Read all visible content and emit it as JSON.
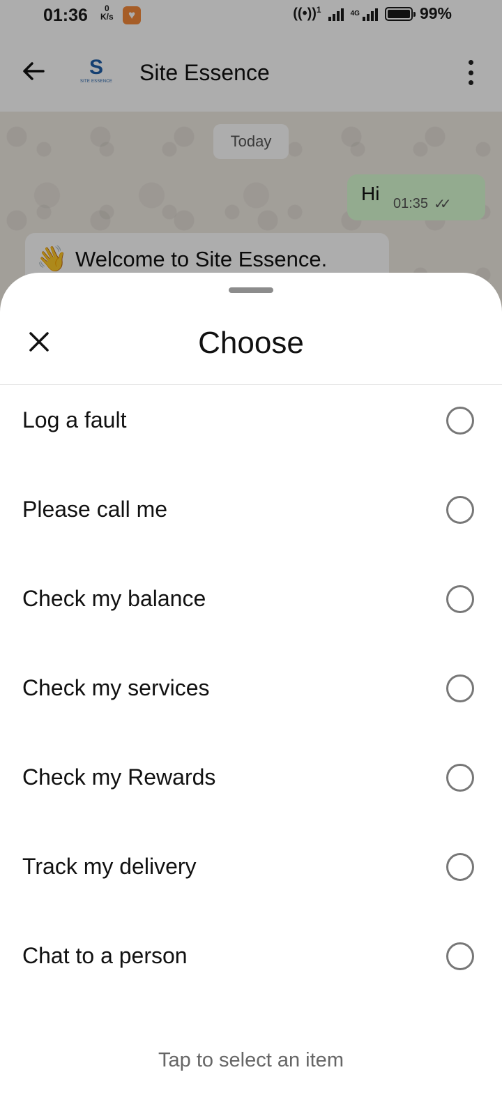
{
  "status_bar": {
    "time": "01:36",
    "speed_value": "0",
    "speed_unit": "K/s",
    "hotspot_label": "1",
    "network_type": "4G",
    "battery_percent": "99%",
    "battery_level": 0.99
  },
  "app_bar": {
    "logo_mark": "S",
    "logo_text": "SITE ESSENCE",
    "title": "Site Essence"
  },
  "chat": {
    "date_chip": "Today",
    "outgoing": {
      "text": "Hi",
      "time": "01:35"
    },
    "incoming": {
      "emoji": "👋",
      "text": "Welcome to Site Essence."
    }
  },
  "sheet": {
    "title": "Choose",
    "options": [
      "Log a fault",
      "Please call me",
      "Check my balance",
      "Check my services",
      "Check my Rewards",
      "Track my delivery",
      "Chat to a person"
    ],
    "footer": "Tap to select an item"
  },
  "colors": {
    "outgoing_bubble": "#d9fdd3",
    "chat_background": "#efeae2",
    "logo_blue": "#1f5fa8"
  }
}
